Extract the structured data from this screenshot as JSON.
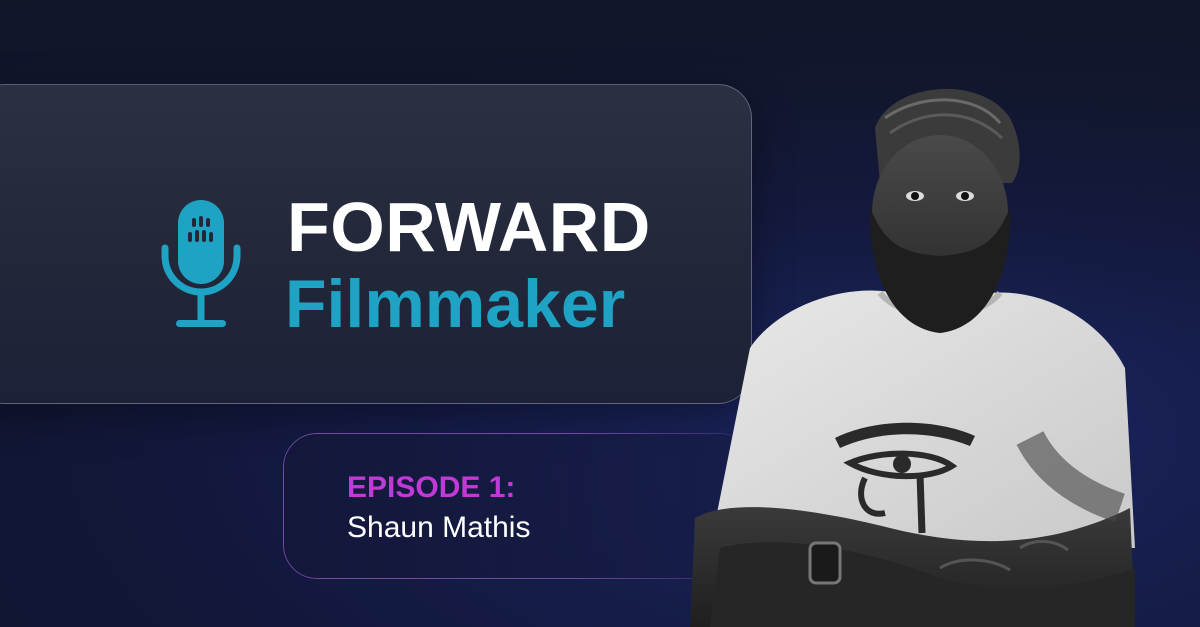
{
  "podcast": {
    "title_line1": "FORWARD",
    "title_line2": "Filmmaker",
    "icon": "microphone-icon"
  },
  "episode": {
    "label": "EPISODE 1:",
    "guest_name": "Shaun Mathis"
  },
  "colors": {
    "accent_teal": "#1fa3c4",
    "accent_magenta": "#c13ad8",
    "background_navy": "#141b45",
    "card": "#262b3d"
  },
  "portrait": {
    "subject": "guest-portrait"
  }
}
